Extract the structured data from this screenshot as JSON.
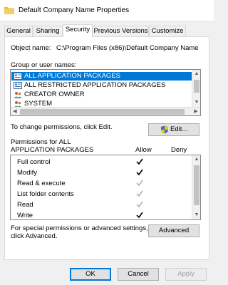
{
  "window": {
    "title": "Default Company Name Properties"
  },
  "tabs": [
    {
      "label": "General",
      "active": false
    },
    {
      "label": "Sharing",
      "active": false
    },
    {
      "label": "Security",
      "active": true
    },
    {
      "label": "Previous Versions",
      "active": false
    },
    {
      "label": "Customize",
      "active": false
    }
  ],
  "security": {
    "object_label": "Object name:",
    "object_value": "C:\\Program Files (x86)\\Default Company Name",
    "group_label": "Group or user names:",
    "groups": [
      {
        "name": "ALL APPLICATION PACKAGES",
        "icon": "app-package-icon",
        "selected": true
      },
      {
        "name": "ALL RESTRICTED APPLICATION PACKAGES",
        "icon": "app-package-icon",
        "selected": false
      },
      {
        "name": "CREATOR OWNER",
        "icon": "users-icon",
        "selected": false
      },
      {
        "name": "SYSTEM",
        "icon": "users-icon",
        "selected": false
      }
    ],
    "change_text": "To change permissions, click Edit.",
    "edit_label": "Edit...",
    "perm_header_line1": "Permissions for ALL",
    "perm_header_line2": "APPLICATION PACKAGES",
    "allow_header": "Allow",
    "deny_header": "Deny",
    "permissions": [
      {
        "name": "Full control",
        "allow": "check",
        "deny": "none"
      },
      {
        "name": "Modify",
        "allow": "check",
        "deny": "none"
      },
      {
        "name": "Read & execute",
        "allow": "check-gray",
        "deny": "none"
      },
      {
        "name": "List folder contents",
        "allow": "check-gray",
        "deny": "none"
      },
      {
        "name": "Read",
        "allow": "check-gray",
        "deny": "none"
      },
      {
        "name": "Write",
        "allow": "check",
        "deny": "none"
      }
    ],
    "special_line1": "For special permissions or advanced settings,",
    "special_line2": "click Advanced.",
    "advanced_label": "Advanced"
  },
  "footer": {
    "ok_label": "OK",
    "cancel_label": "Cancel",
    "apply_label": "Apply"
  },
  "colors": {
    "selection": "#0078d7",
    "check_dark": "#000000",
    "check_gray": "#b0b0b0",
    "shield_blue": "#2f6fd0",
    "shield_yellow": "#f2c40a"
  }
}
